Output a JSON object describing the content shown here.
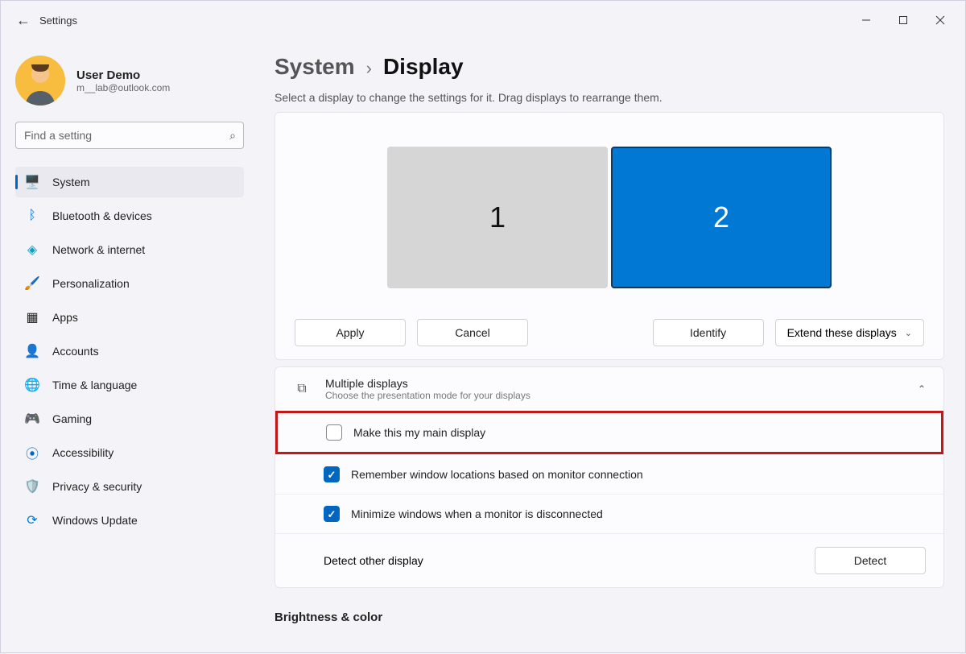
{
  "window": {
    "title": "Settings"
  },
  "user": {
    "name": "User Demo",
    "email": "m__lab@outlook.com"
  },
  "search": {
    "placeholder": "Find a setting"
  },
  "nav": {
    "system": "System",
    "bluetooth": "Bluetooth & devices",
    "network": "Network & internet",
    "personalization": "Personalization",
    "apps": "Apps",
    "accounts": "Accounts",
    "time": "Time & language",
    "gaming": "Gaming",
    "accessibility": "Accessibility",
    "privacy": "Privacy & security",
    "update": "Windows Update"
  },
  "breadcrumb": {
    "parent": "System",
    "current": "Display"
  },
  "helper": "Select a display to change the settings for it. Drag displays to rearrange them.",
  "monitors": {
    "one": "1",
    "two": "2"
  },
  "buttons": {
    "apply": "Apply",
    "cancel": "Cancel",
    "identify": "Identify",
    "extend": "Extend these displays",
    "detect": "Detect"
  },
  "multiple": {
    "title": "Multiple displays",
    "subtitle": "Choose the presentation mode for your displays",
    "main_display": "Make this my main display",
    "remember": "Remember window locations based on monitor connection",
    "minimize": "Minimize windows when a monitor is disconnected",
    "detect_other": "Detect other display"
  },
  "sections": {
    "brightness": "Brightness & color"
  }
}
